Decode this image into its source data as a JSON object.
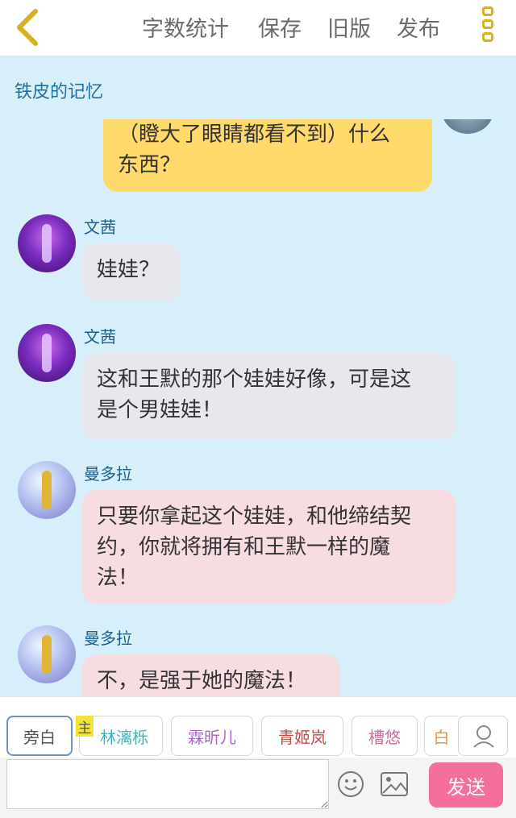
{
  "header": {
    "back_icon": "chevron-left-icon",
    "menu": [
      "字数统计",
      "保存",
      "旧版",
      "发布"
    ],
    "more_icon": "vertical-dots-icon",
    "accent_color": "#d4b21f"
  },
  "story": {
    "title": "铁皮的记忆"
  },
  "messages": [
    {
      "speaker": "",
      "text_lines": [
        "（瞪大了眼睛都看不到）什么",
        "东西？"
      ],
      "style": "yellow"
    },
    {
      "speaker": "文茜",
      "text_lines": [
        "娃娃？"
      ],
      "style": "grey"
    },
    {
      "speaker": "文茜",
      "text_lines": [
        "这和王默的那个娃娃好像，可是这",
        "是个男娃娃！"
      ],
      "style": "grey"
    },
    {
      "speaker": "曼多拉",
      "text_lines": [
        "只要你拿起这个娃娃，和他缔结契",
        "约，你就将拥有和王默一样的魔",
        "法！"
      ],
      "style": "pink"
    },
    {
      "speaker": "曼多拉",
      "text_lines": [
        "不，是强于她的魔法！"
      ],
      "style": "pink"
    }
  ],
  "roles": {
    "narrator": "旁白",
    "main_badge": "主",
    "characters": [
      "林漓栎",
      "霖昕儿",
      "青姬岚",
      "槽悠",
      "白"
    ],
    "colors": [
      "#3db3b8",
      "#a368c9",
      "#c94747",
      "#c96aa0",
      "#e89a3c"
    ]
  },
  "input": {
    "placeholder": "",
    "value": ""
  },
  "toolbar": {
    "emoji_icon": "smiley-icon",
    "image_icon": "image-icon",
    "send_label": "发送"
  }
}
